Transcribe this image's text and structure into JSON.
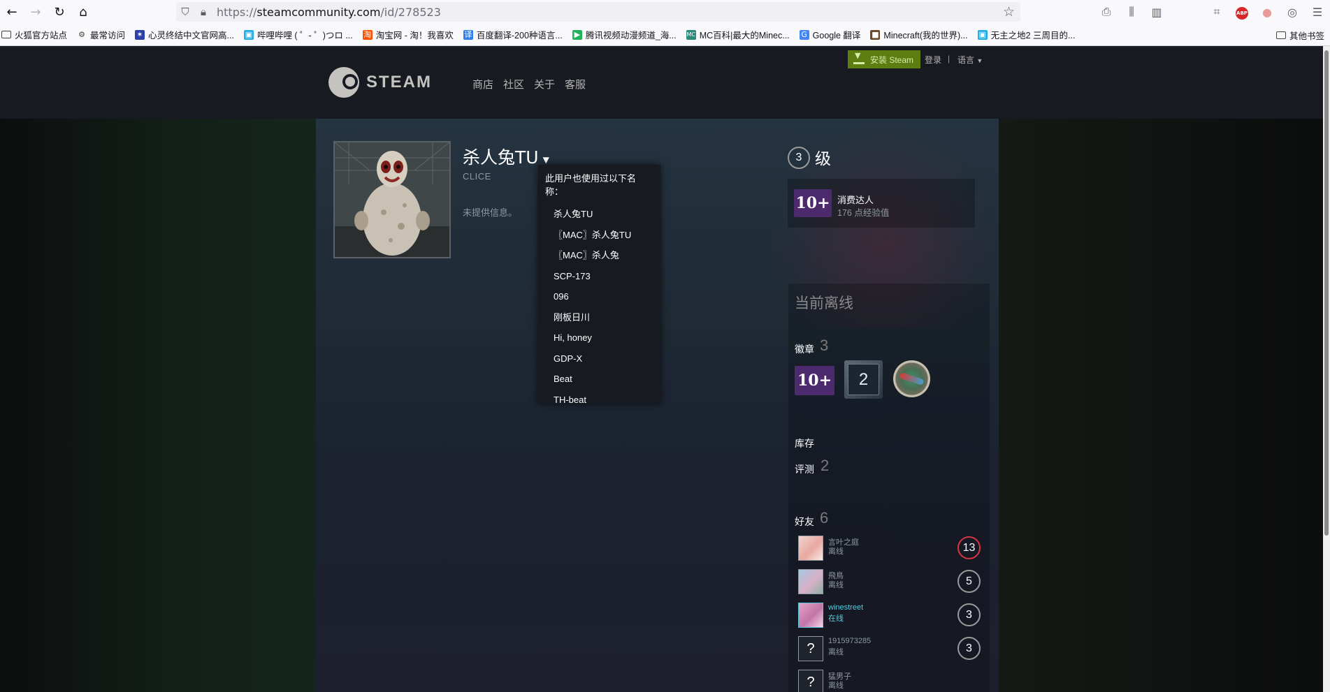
{
  "browser": {
    "url_prefix": "https://",
    "url_host": "steamcommunity.com",
    "url_path": "/id/278523",
    "bookmarks": [
      "火狐官方站点",
      "最常访问",
      "心灵终结中文官网高...",
      "哔哩哔哩 ( ゜- ゜)つロ ...",
      "淘宝网 - 淘！我喜欢",
      "百度翻译-200种语言...",
      "腾讯视频动漫频道_海...",
      "MC百科|最大的Minec...",
      "Google 翻译",
      "Minecraft(我的世界)...",
      "无主之地2 三周目的..."
    ],
    "other_bookmarks": "其他书签",
    "abp_label": "ABP"
  },
  "header": {
    "logo_text": "STEAM",
    "nav": [
      "商店",
      "社区",
      "关于",
      "客服"
    ],
    "install": "安装 Steam",
    "login": "登录",
    "sep": "|",
    "language": "语言"
  },
  "profile": {
    "persona_name": "杀人兔TU",
    "real_name": "CLICE",
    "summary": "未提供信息。",
    "aliases_header": "此用户也使用过以下名称：",
    "aliases": [
      "杀人兔TU",
      "〖MAC〗杀人兔TU",
      "〖MAC〗杀人兔",
      "SCP-173",
      "096",
      "刚板日川",
      "Hi, honey",
      "GDP-X",
      "Beat",
      "TH-beat"
    ]
  },
  "level": {
    "value": "3",
    "label": "级",
    "badge_icon_text": "10+",
    "badge_title": "消费达人",
    "badge_xp": "176 点经验值"
  },
  "sidebar": {
    "status": "当前离线",
    "badges_label": "徽章",
    "badges_count": "3",
    "badge_2_text": "2",
    "inventory_label": "库存",
    "reviews_label": "评测",
    "reviews_count": "2",
    "friends_label": "好友",
    "friends_count": "6"
  },
  "friends": [
    {
      "name": "言叶之庭",
      "status": "离线",
      "level": "13"
    },
    {
      "name": "飛鳥",
      "status": "离线",
      "level": "5"
    },
    {
      "name": "winestreet",
      "status": "在线",
      "level": "3"
    },
    {
      "name": "1915973285",
      "status": "离线",
      "level": "3"
    },
    {
      "name": "猛男子",
      "status": "离线",
      "level": ""
    }
  ],
  "colors": {
    "header_bg": "#171a21",
    "install_green": "#5c7e10",
    "online_blue": "#57cbde",
    "level_red": "#d83445"
  }
}
